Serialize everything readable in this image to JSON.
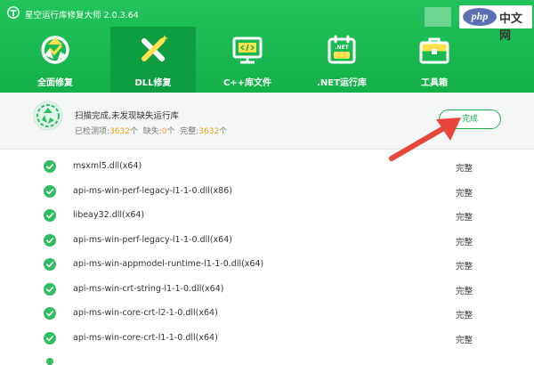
{
  "window": {
    "title": "星空运行库修复大师 2.0.3.64"
  },
  "watermark": {
    "logo": "php",
    "text": "中文网"
  },
  "tabs": [
    {
      "label": "全面修复",
      "icon": "recycle-shield-icon",
      "active": false
    },
    {
      "label": "DLL修复",
      "icon": "tools-cross-icon",
      "active": true
    },
    {
      "label": "C++库文件",
      "icon": "code-monitor-icon",
      "active": false
    },
    {
      "label": ".NET运行库",
      "icon": "net-calendar-icon",
      "active": false
    },
    {
      "label": "工具箱",
      "icon": "toolbox-icon",
      "active": false
    }
  ],
  "status": {
    "title": "扫描完成,未发现缺失运行库",
    "checked_label": "已检测项:",
    "checked_value": "3632",
    "checked_unit": "个",
    "missing_label": "缺失:",
    "missing_value": "0",
    "missing_unit": "个",
    "complete_label": "完整:",
    "complete_value": "3632",
    "complete_unit": "个",
    "done_button": "完成"
  },
  "files": [
    {
      "name": "msxml5.dll(x64)",
      "status": "完整"
    },
    {
      "name": "api-ms-win-perf-legacy-l1-1-0.dll(x86)",
      "status": "完整"
    },
    {
      "name": "libeay32.dll(x64)",
      "status": "完整"
    },
    {
      "name": "api-ms-win-perf-legacy-l1-1-0.dll(x64)",
      "status": "完整"
    },
    {
      "name": "api-ms-win-appmodel-runtime-l1-1-0.dll(x64)",
      "status": "完整"
    },
    {
      "name": "api-ms-win-crt-string-l1-1-0.dll(x64)",
      "status": "完整"
    },
    {
      "name": "api-ms-win-core-crt-l2-1-0.dll(x64)",
      "status": "完整"
    },
    {
      "name": "api-ms-win-core-crt-l1-1-0.dll(x64)",
      "status": "完整"
    }
  ],
  "colors": {
    "header": "#17b04b",
    "active_tab": "#0e9d41",
    "accent_orange": "#f39c12",
    "arrow": "#e8463a"
  }
}
